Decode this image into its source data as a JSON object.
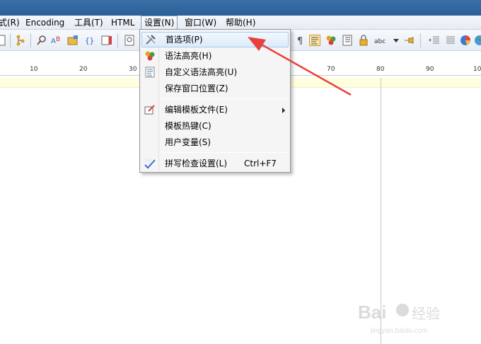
{
  "menubar": {
    "items": [
      {
        "label": "式(R)"
      },
      {
        "label": "Encoding"
      },
      {
        "label": "工具(T)"
      },
      {
        "label": "HTML"
      },
      {
        "label": "设置(N)"
      },
      {
        "label": "窗口(W)"
      },
      {
        "label": "帮助(H)"
      }
    ]
  },
  "ruler": {
    "labels": [
      "10",
      "20",
      "30",
      "70",
      "80",
      "90",
      "10"
    ]
  },
  "settings_menu": {
    "items": [
      {
        "label": "首选项(P)",
        "shortcut": "",
        "icon": "preferences-icon",
        "highlighted": true
      },
      {
        "label": "语法高亮(H)",
        "shortcut": "",
        "icon": "syntax-highlight-icon"
      },
      {
        "label": "自定义语法高亮(U)",
        "shortcut": "",
        "icon": "custom-syntax-icon"
      },
      {
        "label": "保存窗口位置(Z)",
        "shortcut": "",
        "icon": ""
      },
      {
        "label": "编辑模板文件(E)",
        "shortcut": "",
        "icon": "edit-template-icon",
        "submenu": true
      },
      {
        "label": "模板热键(C)",
        "shortcut": "",
        "icon": ""
      },
      {
        "label": "用户变量(S)",
        "shortcut": "",
        "icon": ""
      },
      {
        "label": "拼写检查设置(L)",
        "shortcut": "Ctrl+F7",
        "icon": "spellcheck-icon"
      }
    ]
  },
  "colors": {
    "titlebar": "#2b5f98",
    "annotation_arrow": "#e8413c",
    "current_line": "#ffffe0",
    "menu_highlight": "#dcebfa"
  }
}
